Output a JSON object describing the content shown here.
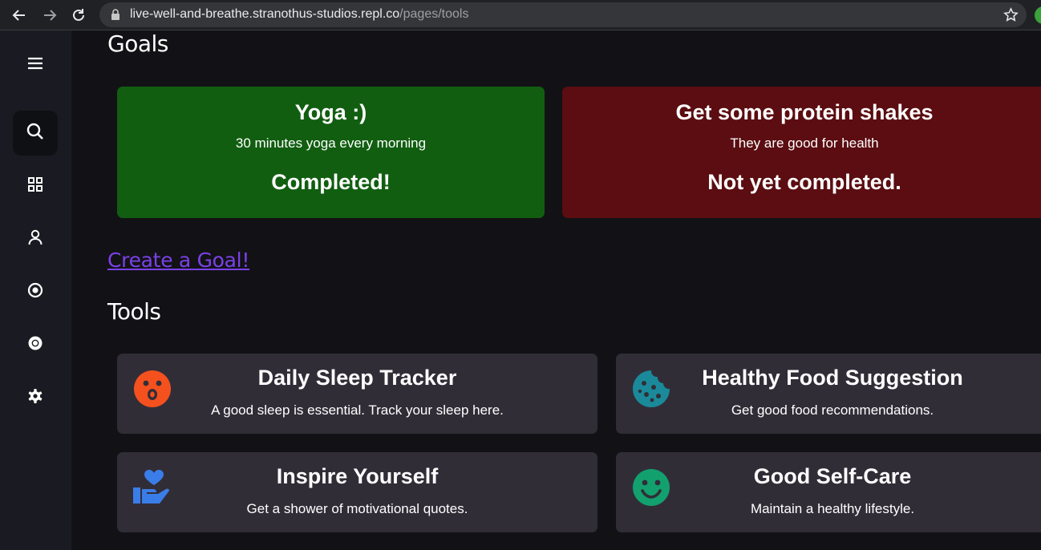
{
  "browser": {
    "url_host": "live-well-and-breathe.stranothus-studios.repl.co",
    "url_path": "/pages/tools",
    "icons": [
      "back-arrow-icon",
      "forward-arrow-icon",
      "reload-icon",
      "lock-icon",
      "star-icon"
    ]
  },
  "sidebar": {
    "items": [
      {
        "icon": "menu-icon"
      },
      {
        "icon": "search-icon",
        "active": true
      },
      {
        "icon": "dashboard-icon"
      },
      {
        "icon": "user-icon"
      },
      {
        "icon": "target-icon"
      },
      {
        "icon": "chrome-icon"
      },
      {
        "icon": "gear-icon"
      }
    ]
  },
  "goals": {
    "heading": "Goals",
    "items": [
      {
        "title": "Yoga :)",
        "description": "30 minutes yoga every morning",
        "status": "Completed!",
        "color": "#115e11"
      },
      {
        "title": "Get some protein shakes",
        "description": "They are good for health",
        "status": "Not yet completed.",
        "color": "#5b0d11"
      }
    ],
    "create_link": "Create a Goal!"
  },
  "tools": {
    "heading": "Tools",
    "items": [
      {
        "title": "Daily Sleep Tracker",
        "description": "A good sleep is essential. Track your sleep here.",
        "icon": "surprised-face-icon",
        "icon_color": "#f4511e"
      },
      {
        "title": "Healthy Food Suggestion",
        "description": "Get good food recommendations.",
        "icon": "cookie-icon",
        "icon_color": "#1a8a9a"
      },
      {
        "title": "Inspire Yourself",
        "description": "Get a shower of motivational quotes.",
        "icon": "hand-heart-icon",
        "icon_color": "#3b7de8"
      },
      {
        "title": "Good Self-Care",
        "description": "Maintain a healthy lifestyle.",
        "icon": "smile-face-icon",
        "icon_color": "#12a06e"
      }
    ]
  },
  "colors": {
    "background": "#121216",
    "sidebar": "#1a1b22",
    "tool_card": "#312d37",
    "link": "#7b41e8"
  }
}
